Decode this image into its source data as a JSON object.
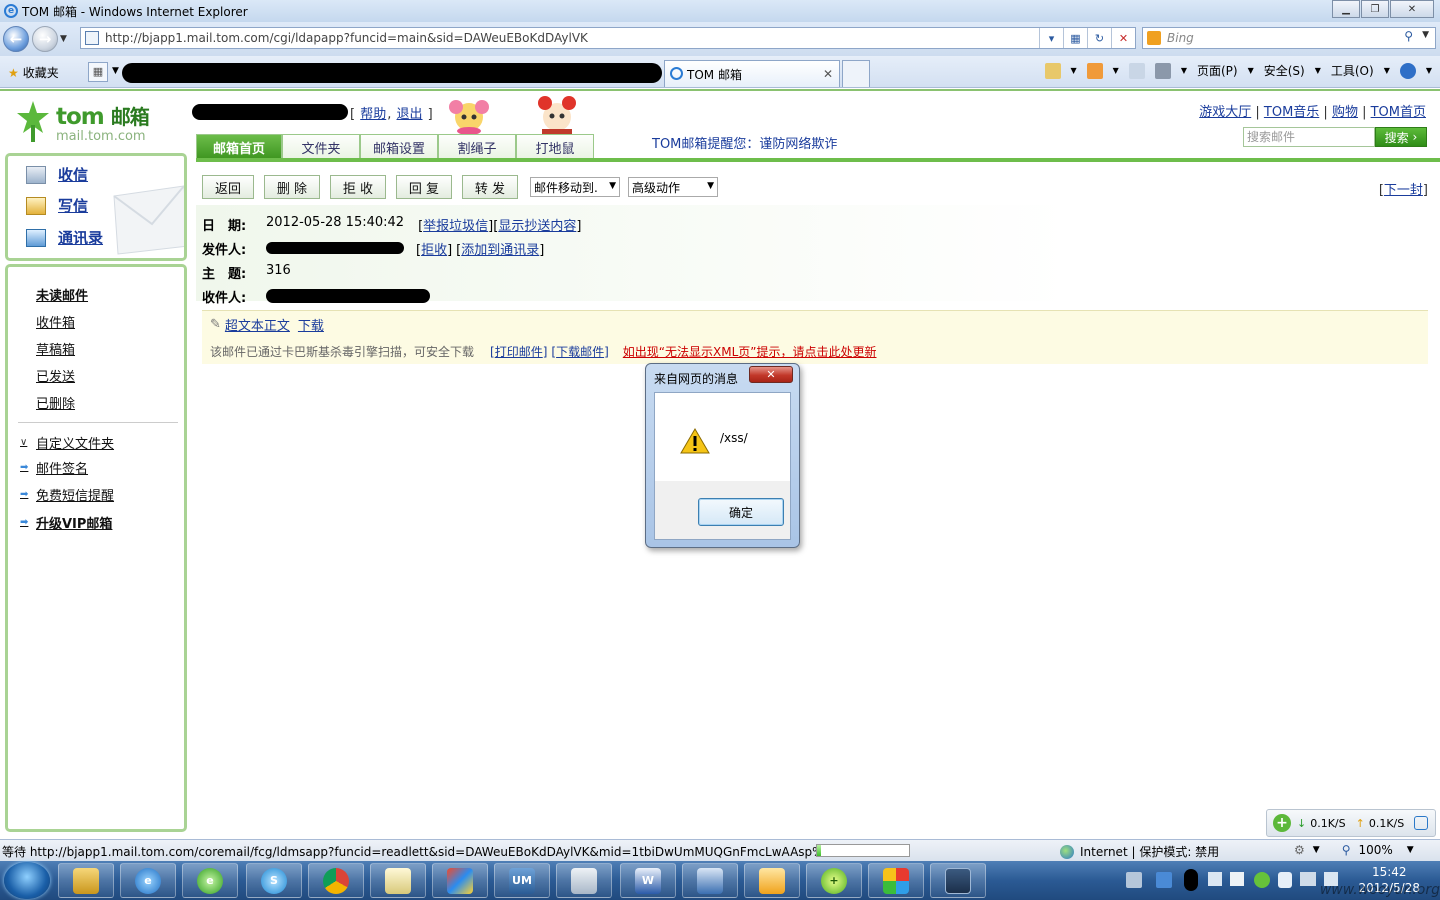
{
  "window": {
    "title": "TOM 邮箱 - Windows Internet Explorer",
    "url": "http://bjapp1.mail.tom.com/cgi/ldapapp?funcid=main&sid=DAWeuEBoKdDAylVK",
    "search_placeholder": "Bing",
    "favorites_label": "收藏夹",
    "tab_title": "TOM 邮箱",
    "cmd": {
      "page": "页面(P)",
      "safety": "安全(S)",
      "tools": "工具(O)"
    }
  },
  "header": {
    "brand": "tom",
    "brand_cn": "邮箱",
    "domain": "mail.tom.com",
    "help": "帮助",
    "logout": "退出",
    "top_links": [
      "游戏大厅",
      "TOM音乐",
      "购物",
      "TOM首页"
    ],
    "search_placeholder": "搜索邮件",
    "search_button": "搜索",
    "notice": "TOM邮箱提醒您：谨防网络欺诈",
    "tabs": [
      "邮箱首页",
      "文件夹",
      "邮箱设置",
      "割绳子",
      "打地鼠"
    ]
  },
  "sidebar": {
    "main": [
      "收信",
      "写信",
      "通讯录"
    ],
    "folders": [
      "未读邮件",
      "收件箱",
      "草稿箱",
      "已发送",
      "已删除"
    ],
    "options": [
      "自定义文件夹",
      "邮件签名",
      "免费短信提醒",
      "升级VIP邮箱"
    ]
  },
  "toolbar": {
    "buttons": [
      "返回",
      "删 除",
      "拒 收",
      "回 复",
      "转 发"
    ],
    "move_select": "邮件移动到.",
    "advanced_select": "高级动作",
    "next": "下一封"
  },
  "message": {
    "date_label": "日　期:",
    "date": "2012-05-28 15:40:42",
    "report_spam": "举报垃圾信",
    "show_cc": "显示抄送内容",
    "sender_label": "发件人:",
    "reject": "拒收",
    "add_contact": "添加到通讯录",
    "subject_label": "主　题:",
    "subject": "316",
    "recipient_label": "收件人:",
    "hypertext": "超文本正文",
    "download": "下载",
    "scan_notice": "该邮件已通过卡巴斯基杀毒引擎扫描，可安全下载",
    "print": "打印邮件",
    "download_mail": "下载邮件",
    "xml_notice": "如出现“无法显示XML页”提示，请点击此处更新"
  },
  "dialog": {
    "title": "来自网页的消息",
    "message": "/xss/",
    "ok": "确定"
  },
  "speed": {
    "down": "0.1K/S",
    "up": "0.1K/S"
  },
  "status": {
    "text": "等待 http://bjapp1.mail.tom.com/coremail/fcg/ldmsapp?funcid=readlett&sid=DAWeuEBoKdDAylVK&mid=1tbiDwUmMUQGnFmcLwAAsp%0",
    "zone": "Internet | 保护模式: 禁用",
    "zoom": "100%",
    "progress": 0.04
  },
  "taskbar": {
    "apps": [
      "explorer",
      "ie",
      "ie-green",
      "skype",
      "chrome",
      "notepad",
      "feather",
      "um",
      "docs",
      "word",
      "network",
      "outlook",
      "360",
      "gallery",
      "grapher"
    ],
    "time": "15:42",
    "date": "2012/5/28"
  },
  "watermark": "www.wooyun.org"
}
